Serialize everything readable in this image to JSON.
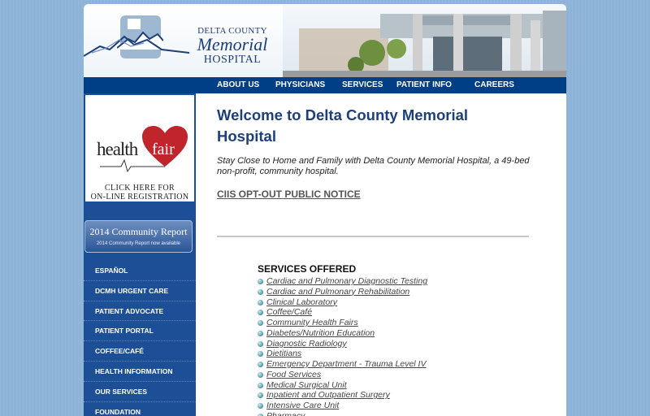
{
  "header": {
    "logo_line1": "DELTA COUNTY",
    "logo_line2": "Memorial",
    "logo_line3": "HOSPITAL"
  },
  "nav": {
    "items": [
      "ABOUT US",
      "PHYSICIANS",
      "SERVICES",
      "PATIENT INFO",
      "CAREERS"
    ]
  },
  "sidebar": {
    "healthfair": {
      "word1": "health",
      "word2": "fair",
      "click_line1": "CLICK HERE FOR",
      "click_line2": "ON-LINE REGISTRATION"
    },
    "community_report": {
      "title": "2014 Community Report",
      "subtitle": "2014 Community Report now available"
    },
    "menu": [
      "ESPAÑOL",
      "DCMH URGENT CARE",
      "PATIENT ADVOCATE",
      "PATIENT PORTAL",
      "COFFEE/CAFÉ",
      "HEALTH INFORMATION",
      "OUR SERVICES",
      "FOUNDATION"
    ]
  },
  "main": {
    "title": "Welcome to Delta County Memorial Hospital",
    "intro": "Stay Close to Home and Family with Delta County Memorial Hospital, a 49-bed non-profit, community hospital.",
    "notice_link": "CIIS OPT-OUT PUBLIC NOTICE",
    "services_heading": "SERVICES OFFERED",
    "services": [
      "Cardiac and Pulmonary Diagnostic Testing",
      "Cardiac and Pulmonary Rehabilitation",
      "Clinical Laboratory",
      "Coffee/Café",
      "Community Health Fairs",
      "Diabetes/Nutrition Education",
      "Diagnostic Radiology",
      "Dietitians",
      "Emergency Department - Trauma Level IV",
      "Food Services",
      "Medical Surgical Unit",
      "Inpatient and Outpatient Surgery",
      "Intensive Care Unit",
      "Pharmacy"
    ]
  },
  "colors": {
    "background": "#8db4d8",
    "nav": "#003f86",
    "sidebar": "#1c4f95",
    "title": "#1d3f7a",
    "heart": "#c0252c"
  }
}
